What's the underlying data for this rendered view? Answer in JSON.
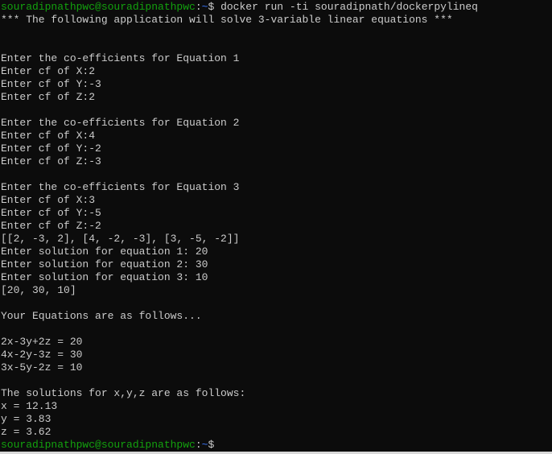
{
  "prompt": {
    "user_host": "souradipnathpwc@souradipnathpwc",
    "sep": ":",
    "path": "~",
    "symbol": "$"
  },
  "command": " docker run -ti souradipnath/dockerpylineq",
  "lines": [
    "*** The following application will solve 3-variable linear equations ***",
    "",
    "",
    "Enter the co-efficients for Equation 1",
    "Enter cf of X:2",
    "Enter cf of Y:-3",
    "Enter cf of Z:2",
    "",
    "Enter the co-efficients for Equation 2",
    "Enter cf of X:4",
    "Enter cf of Y:-2",
    "Enter cf of Z:-3",
    "",
    "Enter the co-efficients for Equation 3",
    "Enter cf of X:3",
    "Enter cf of Y:-5",
    "Enter cf of Z:-2",
    "[[2, -3, 2], [4, -2, -3], [3, -5, -2]]",
    "Enter solution for equation 1: 20",
    "Enter solution for equation 2: 30",
    "Enter solution for equation 3: 10",
    "[20, 30, 10]",
    "",
    "Your Equations are as follows...",
    "",
    "2x-3y+2z = 20",
    "4x-2y-3z = 30",
    "3x-5y-2z = 10",
    "",
    "The solutions for x,y,z are as follows:",
    "x = 12.13",
    "y = 3.83",
    "z = 3.62"
  ],
  "colors": {
    "background": "#0c0c0c",
    "text": "#cccccc",
    "prompt_user": "#13a10e",
    "prompt_path": "#3b78ff"
  }
}
